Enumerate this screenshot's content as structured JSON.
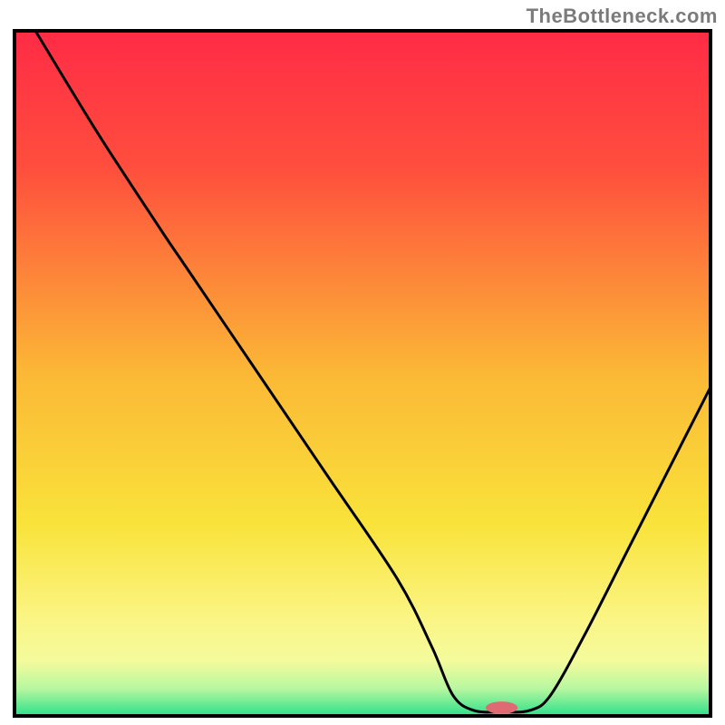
{
  "watermark": "TheBottleneck.com",
  "chart_data": {
    "type": "line",
    "title": "",
    "xlabel": "",
    "ylabel": "",
    "xlim": [
      0,
      100
    ],
    "ylim": [
      0,
      100
    ],
    "grid": false,
    "gradient_stops": [
      {
        "offset": 0,
        "color": "#ff2b46"
      },
      {
        "offset": 20,
        "color": "#ff4e3d"
      },
      {
        "offset": 50,
        "color": "#fbb836"
      },
      {
        "offset": 72,
        "color": "#f9e33a"
      },
      {
        "offset": 86,
        "color": "#faf585"
      },
      {
        "offset": 92,
        "color": "#f4fb9c"
      },
      {
        "offset": 96,
        "color": "#b8f7a0"
      },
      {
        "offset": 100,
        "color": "#2de08a"
      }
    ],
    "curve": [
      {
        "x": 3,
        "y": 100
      },
      {
        "x": 12,
        "y": 85
      },
      {
        "x": 21,
        "y": 71
      },
      {
        "x": 25,
        "y": 65
      },
      {
        "x": 35,
        "y": 50
      },
      {
        "x": 45,
        "y": 35
      },
      {
        "x": 55,
        "y": 20
      },
      {
        "x": 60,
        "y": 10
      },
      {
        "x": 63,
        "y": 3
      },
      {
        "x": 66,
        "y": 0.8
      },
      {
        "x": 70,
        "y": 0.6
      },
      {
        "x": 74,
        "y": 0.8
      },
      {
        "x": 77,
        "y": 3
      },
      {
        "x": 82,
        "y": 12
      },
      {
        "x": 88,
        "y": 24
      },
      {
        "x": 94,
        "y": 36
      },
      {
        "x": 100,
        "y": 48
      }
    ],
    "marker": {
      "x": 70,
      "y": 1.2,
      "rx": 2.3,
      "ry": 0.9,
      "color": "#e06a74"
    },
    "frame_color": "#000000",
    "curve_color": "#000000"
  }
}
